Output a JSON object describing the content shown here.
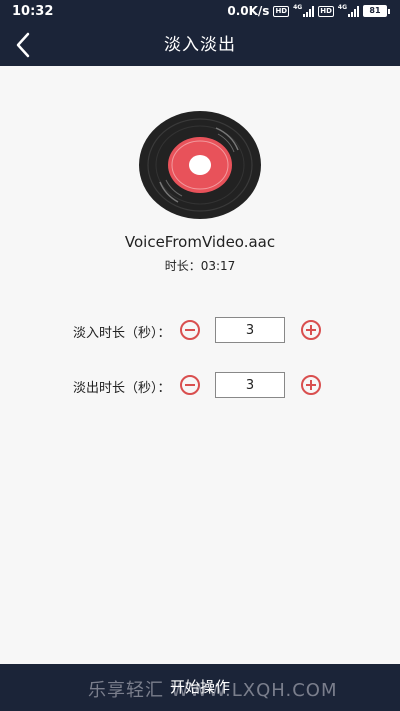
{
  "status_bar": {
    "time": "10:32",
    "speed": "0.0K/s",
    "hd": "HD",
    "network": "4G",
    "battery": "81"
  },
  "header": {
    "title": "淡入淡出",
    "back_icon": "chevron-left-icon"
  },
  "track": {
    "file_name": "VoiceFromVideo.aac",
    "duration_label": "时长：",
    "duration_value": "03:17"
  },
  "fade_in": {
    "label": "淡入时长（秒）：",
    "value": "3"
  },
  "fade_out": {
    "label": "淡出时长（秒）：",
    "value": "3"
  },
  "action": {
    "start_label": "开始操作"
  },
  "watermark": "乐享轻汇 WWW.LXQH.COM",
  "colors": {
    "bar": "#1b2438",
    "accent": "#d94f4f",
    "background": "#f7f7f7"
  }
}
